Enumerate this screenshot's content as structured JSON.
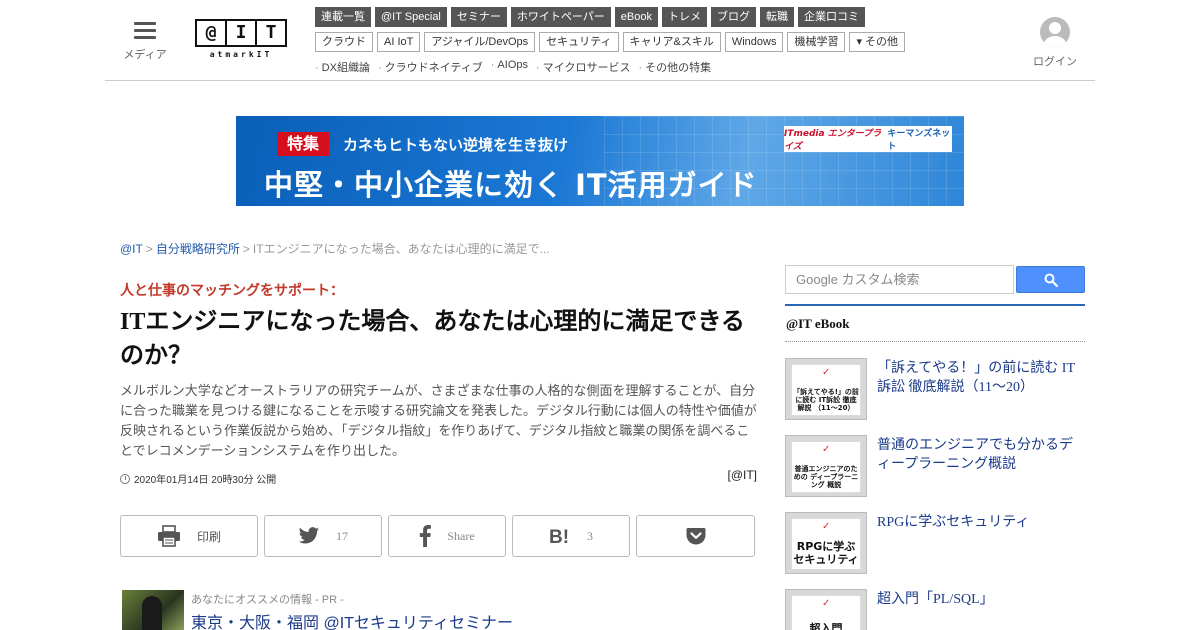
{
  "header": {
    "menu_label": "メディア",
    "logo_chars": [
      "@",
      "I",
      "T"
    ],
    "logo_sub": "atmarkIT",
    "login_label": "ログイン",
    "nav_primary": [
      "連載一覧",
      "@IT Special",
      "セミナー",
      "ホワイトペーパー",
      "eBook",
      "トレメ",
      "ブログ",
      "転職",
      "企業口コミ"
    ],
    "nav_secondary": [
      "クラウド",
      "AI IoT",
      "アジャイル/DevOps",
      "セキュリティ",
      "キャリア&スキル",
      "Windows",
      "機械学習",
      "▾ その他"
    ],
    "nav_features": [
      "DX組織論",
      "クラウドネイティブ",
      "AIOps",
      "マイクロサービス",
      "その他の特集"
    ]
  },
  "banner": {
    "tag": "特集",
    "subtitle": "カネもヒトもない逆境を生き抜け",
    "main": "中堅・中小企業に効く IT活用ガイド",
    "logo1": "ITmedia エンタープライズ",
    "logo2": "キーマンズネット"
  },
  "breadcrumb": {
    "home": "@IT",
    "section": "自分戦略研究所",
    "current": "ITエンジニアになった場合、あなたは心理的に満足で..."
  },
  "article": {
    "kicker": "人と仕事のマッチングをサポート：",
    "title": "ITエンジニアになった場合、あなたは心理的に満足できるのか？",
    "lead": "メルボルン大学などオーストラリアの研究チームが、さまざまな仕事の人格的な側面を理解することが、自分に合った職業を見つける鍵になることを示唆する研究論文を発表した。デジタル行動には個人の特性や価値が反映されるという作業仮説から始め、「デジタル指紋」を作りあげて、デジタル指紋と職業の関係を調べることでレコメンデーションシステムを作り出した。",
    "date": "2020年01月14日 20時30分 公開",
    "credit": "[@IT]"
  },
  "share": {
    "print": "印刷",
    "twitter_count": "17",
    "facebook": "Share",
    "hatena_count": "3"
  },
  "pr": {
    "label": "あなたにオススメの情報 - PR -",
    "link": "東京・大阪・福岡 @ITセキュリティセミナー"
  },
  "sidebar": {
    "search_placeholder": "Google カスタム検索",
    "section_title": "@IT eBook",
    "ebooks": [
      {
        "title": "「訴えてやる！」の前に読む IT訴訟 徹底解説（11～20）",
        "cover": "「訴えてやる!」の前に読む IT訴訟 徹底解説 （11～20）"
      },
      {
        "title": "普通のエンジニアでも分かるディープラーニング概説",
        "cover": "普通エンジニアのための ディープラーニング 概説"
      },
      {
        "title": "RPGに学ぶセキュリティ",
        "cover": "RPGに学ぶ セキュリティ"
      },
      {
        "title": "超入門「PL/SQL」",
        "cover": "超入門"
      }
    ]
  },
  "colors": {
    "nav_dark": "#555555",
    "accent_red": "#c0392b",
    "link_blue": "#1a3a8a",
    "search_blue": "#4d90fe"
  }
}
